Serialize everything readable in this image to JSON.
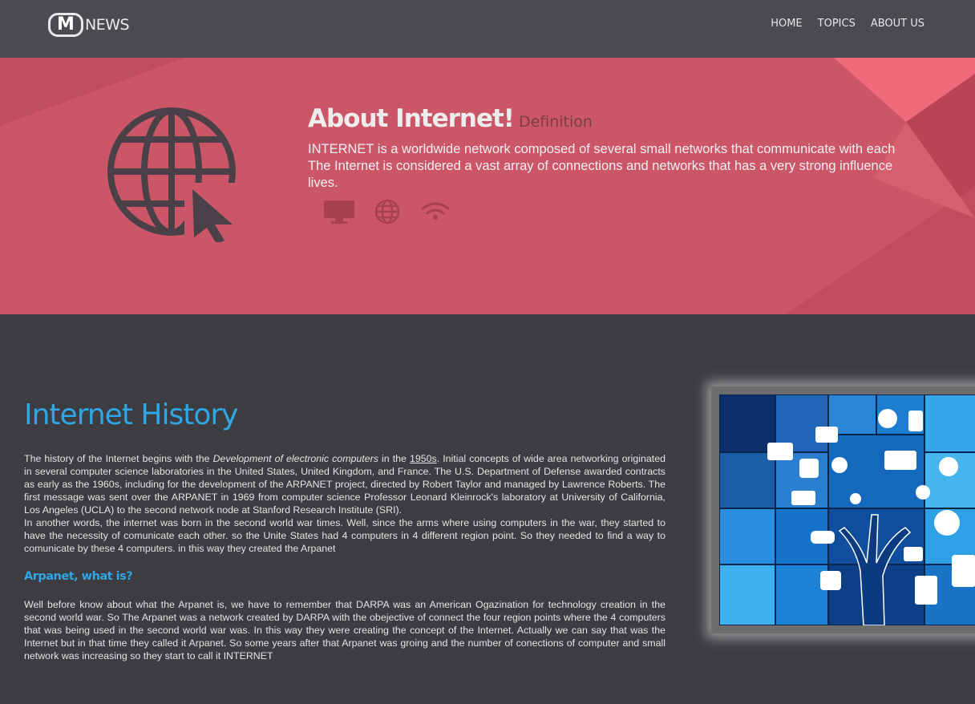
{
  "header": {
    "logo_letter": "M",
    "logo_text": "NEWS",
    "nav": [
      "HOME",
      "TOPICS",
      "ABOUT US"
    ]
  },
  "hero": {
    "title": "About Internet!",
    "subtitle": "Definition",
    "text_line1": "INTERNET is a worldwide network composed of several small networks that communicate with each",
    "text_line2": "The Internet is considered a vast array of connections and networks that has a very strong influence",
    "text_line3": "lives.",
    "icons": [
      "monitor-icon",
      "globe-icon",
      "wifi-icon"
    ]
  },
  "content": {
    "title": "Internet History",
    "para1_a": "The history of the Internet begins with the ",
    "para1_em": "Development of electronic computers",
    "para1_b": " in the ",
    "para1_link": "1950s",
    "para1_c": ". Initial concepts of wide area networking originated in several computer science laboratories in the United States, United Kingdom, and France. The U.S. Department of Defense awarded contracts as early as the 1960s, including for the development of the ARPANET project, directed by Robert Taylor and managed by Lawrence Roberts. The first message was sent over the ARPANET in 1969 from computer science Professor Leonard Kleinrock's laboratory at University of California, Los Angeles (UCLA) to the second network node at Stanford Research Institute (SRI).",
    "para1_d": "In another words, the internet was born in the second world war times. Well, since the arms where using computers in the war, they started to have the necessity of comunicate each other. so the Unite States had 4 computers in 4 different region point. So they needed to find a way to comunicate by these 4 computers. in this way they created the Arpanet",
    "subtitle": "Arpanet, what is?",
    "para2": "Well before know about what the Arpanet is, we have to remember that DARPA was an American Ogazination for technology creation in the second world war. So The Arpanet was a network created by DARPA with the obejective of connect the four region points where the 4 computers that was being used in the second world war was. In this way they were creating the concept of the Internet. Actually we can say that was the Internet but in that time they called it Arpanet. So some years after that Arpanet was groing and the number of conections of computer and small network was increasing so they start to call it INTERNET"
  },
  "colors": {
    "header_bg": "#4a4a50",
    "hero_bg": "#cb5667",
    "page_bg": "#3d3c40",
    "accent_blue": "#2fa7e6"
  }
}
